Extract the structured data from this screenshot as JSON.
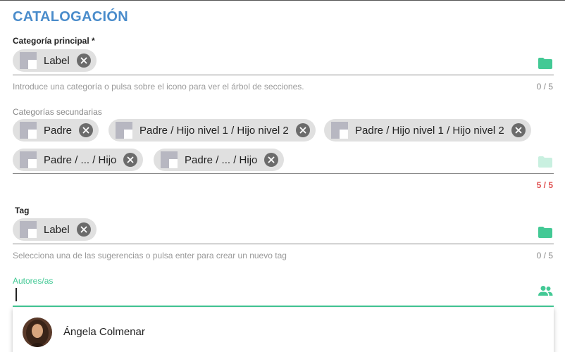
{
  "section_title": "CATALOGACIÓN",
  "main_category": {
    "label": "Categoría principal *",
    "chips": [
      "Label"
    ],
    "hint": "Introduce una categoría o pulsa sobre el icono para ver el árbol de secciones.",
    "counter": "0 / 5"
  },
  "secondary_categories": {
    "label": "Categorías secundarias",
    "chips": [
      "Padre",
      "Padre / Hijo nivel 1 / Hijo nivel 2",
      "Padre / Hijo nivel 1 / Hijo nivel 2",
      "Padre / ... / Hijo",
      "Padre / ... / Hijo"
    ],
    "counter": "5 / 5"
  },
  "tag": {
    "label": "Tag",
    "chips": [
      "Label"
    ],
    "hint": "Selecciona una de las sugerencias o pulsa enter para crear un nuevo tag",
    "counter": "0 / 5"
  },
  "authors": {
    "label": "Autores/as",
    "value": "",
    "suggestions": [
      {
        "name": "Ángela Colmenar"
      }
    ]
  },
  "colors": {
    "accent_blue": "#4a8ccb",
    "accent_green": "#43c995",
    "error_red": "#e05252",
    "chip_bg": "#e0e0e0"
  },
  "icons": {
    "chip": "image-placeholder-icon",
    "remove": "close-circle-icon",
    "tree": "folder-icon",
    "authors": "people-icon"
  }
}
